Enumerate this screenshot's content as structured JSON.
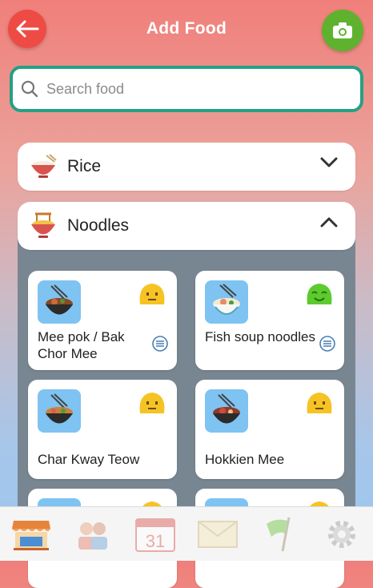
{
  "header": {
    "title": "Add Food"
  },
  "search": {
    "placeholder": "Search food",
    "value": ""
  },
  "categories": [
    {
      "label": "Rice",
      "expanded": false
    },
    {
      "label": "Noodles",
      "expanded": true
    }
  ],
  "foods": [
    {
      "name": "Mee pok / Bak Chor Mee",
      "rating_face": "yellow-neutral",
      "has_info": true
    },
    {
      "name": "Fish soup noodles",
      "rating_face": "green-smile",
      "has_info": true
    },
    {
      "name": "Char Kway Teow",
      "rating_face": "yellow-neutral",
      "has_info": false
    },
    {
      "name": "Hokkien Mee",
      "rating_face": "yellow-neutral",
      "has_info": false
    }
  ],
  "tabbar": {
    "tabs": [
      {
        "icon": "store-icon",
        "active": true
      },
      {
        "icon": "people-icon",
        "active": false
      },
      {
        "icon": "calendar-icon",
        "label": "31",
        "active": false
      },
      {
        "icon": "mail-icon",
        "active": false
      },
      {
        "icon": "flag-icon",
        "active": false
      },
      {
        "icon": "gear-icon",
        "active": false
      }
    ]
  },
  "colors": {
    "accent_red": "#ee4b45",
    "accent_green": "#5fb22d",
    "search_border": "#25a085",
    "panel_gray": "#788692"
  }
}
